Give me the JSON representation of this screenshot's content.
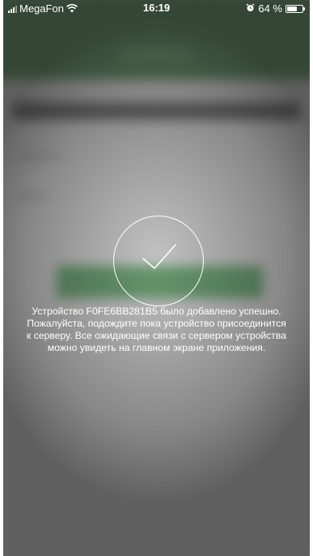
{
  "status_bar": {
    "carrier": "MegaFon",
    "time": "16:19",
    "battery_percent": "64 %",
    "battery_level": 0.64,
    "icons": [
      "signal-icon",
      "wifi-icon",
      "alarm-icon",
      "battery-icon"
    ]
  },
  "success": {
    "icon": "checkmark-icon",
    "message_lines": [
      "Устройство F0FE6BB281B5 было добавлено успешно.",
      "Пожалуйста, подождите пока устройство присоединится",
      "к серверу. Все ожидающие связи с сервером устройства",
      "можно увидеть на главном экране приложения."
    ]
  },
  "colors": {
    "header_green": "#2f6b34",
    "button_green": "#2f7a38",
    "overlay_text": "#ffffff"
  }
}
